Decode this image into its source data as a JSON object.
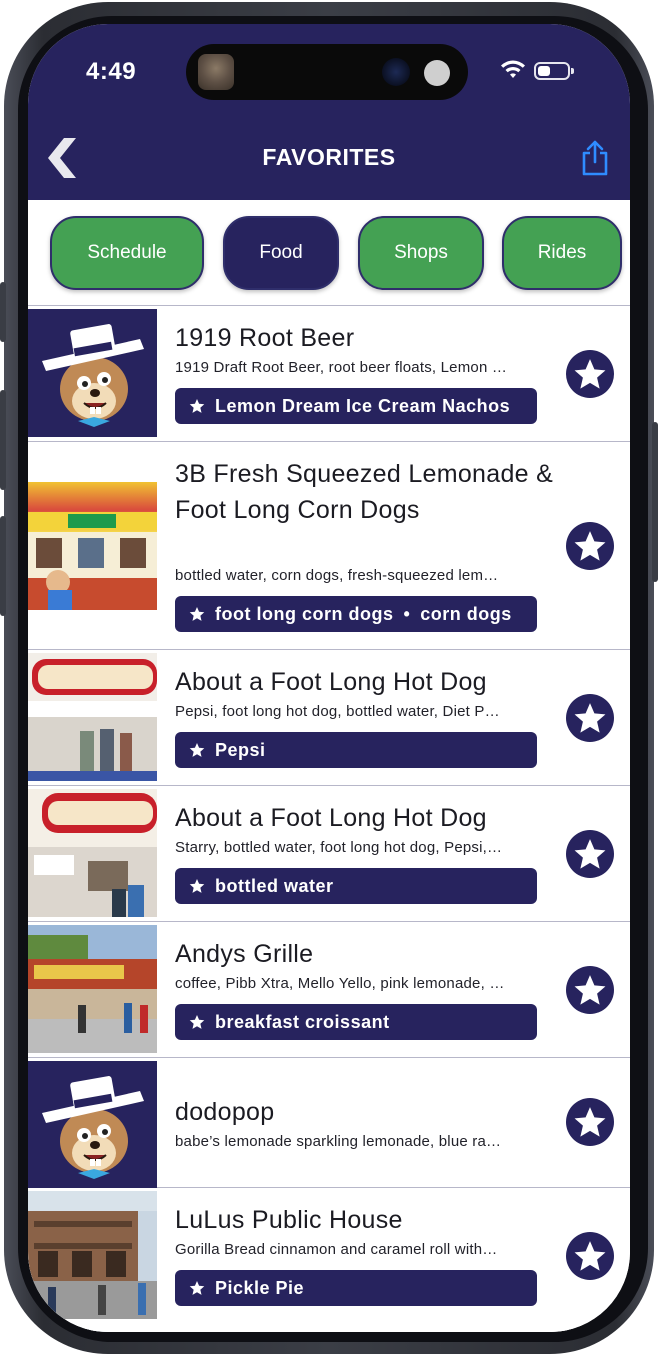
{
  "status": {
    "time": "4:49"
  },
  "header": {
    "title": "FAVORITES"
  },
  "filters": [
    {
      "label": "Schedule",
      "active": false
    },
    {
      "label": "Food",
      "active": true
    },
    {
      "label": "Shops",
      "active": false
    },
    {
      "label": "Rides",
      "active": false
    }
  ],
  "items": [
    {
      "title": "1919 Root Beer",
      "description": "1919 Draft Root Beer, root beer floats, Lemon …",
      "tags": [
        "Lemon Dream Ice Cream Nachos"
      ]
    },
    {
      "title": "3B Fresh Squeezed Lemonade & Foot Long Corn Dogs",
      "description": "bottled water, corn dogs, fresh-squeezed lem…",
      "tags": [
        "foot long corn dogs",
        "corn dogs"
      ]
    },
    {
      "title": "About a Foot Long Hot Dog",
      "description": "Pepsi, foot long hot dog, bottled water, Diet P…",
      "tags": [
        "Pepsi"
      ]
    },
    {
      "title": "About a Foot Long Hot Dog",
      "description": "Starry, bottled water, foot long hot dog, Pepsi,…",
      "tags": [
        "bottled water"
      ]
    },
    {
      "title": "Andys Grille",
      "description": "coffee, Pibb Xtra, Mello Yello, pink lemonade, …",
      "tags": [
        "breakfast croissant"
      ]
    },
    {
      "title": "dodopop",
      "description": "babe’s lemonade sparkling lemonade, blue ra…",
      "tags": []
    },
    {
      "title": "LuLus Public House",
      "description": "Gorilla Bread cinnamon and caramel roll with…",
      "tags": [
        "Pickle Pie"
      ]
    }
  ],
  "tag_separator": "•",
  "colors": {
    "navy": "#27235e",
    "green": "#44a153",
    "share_blue": "#2f8cff"
  }
}
